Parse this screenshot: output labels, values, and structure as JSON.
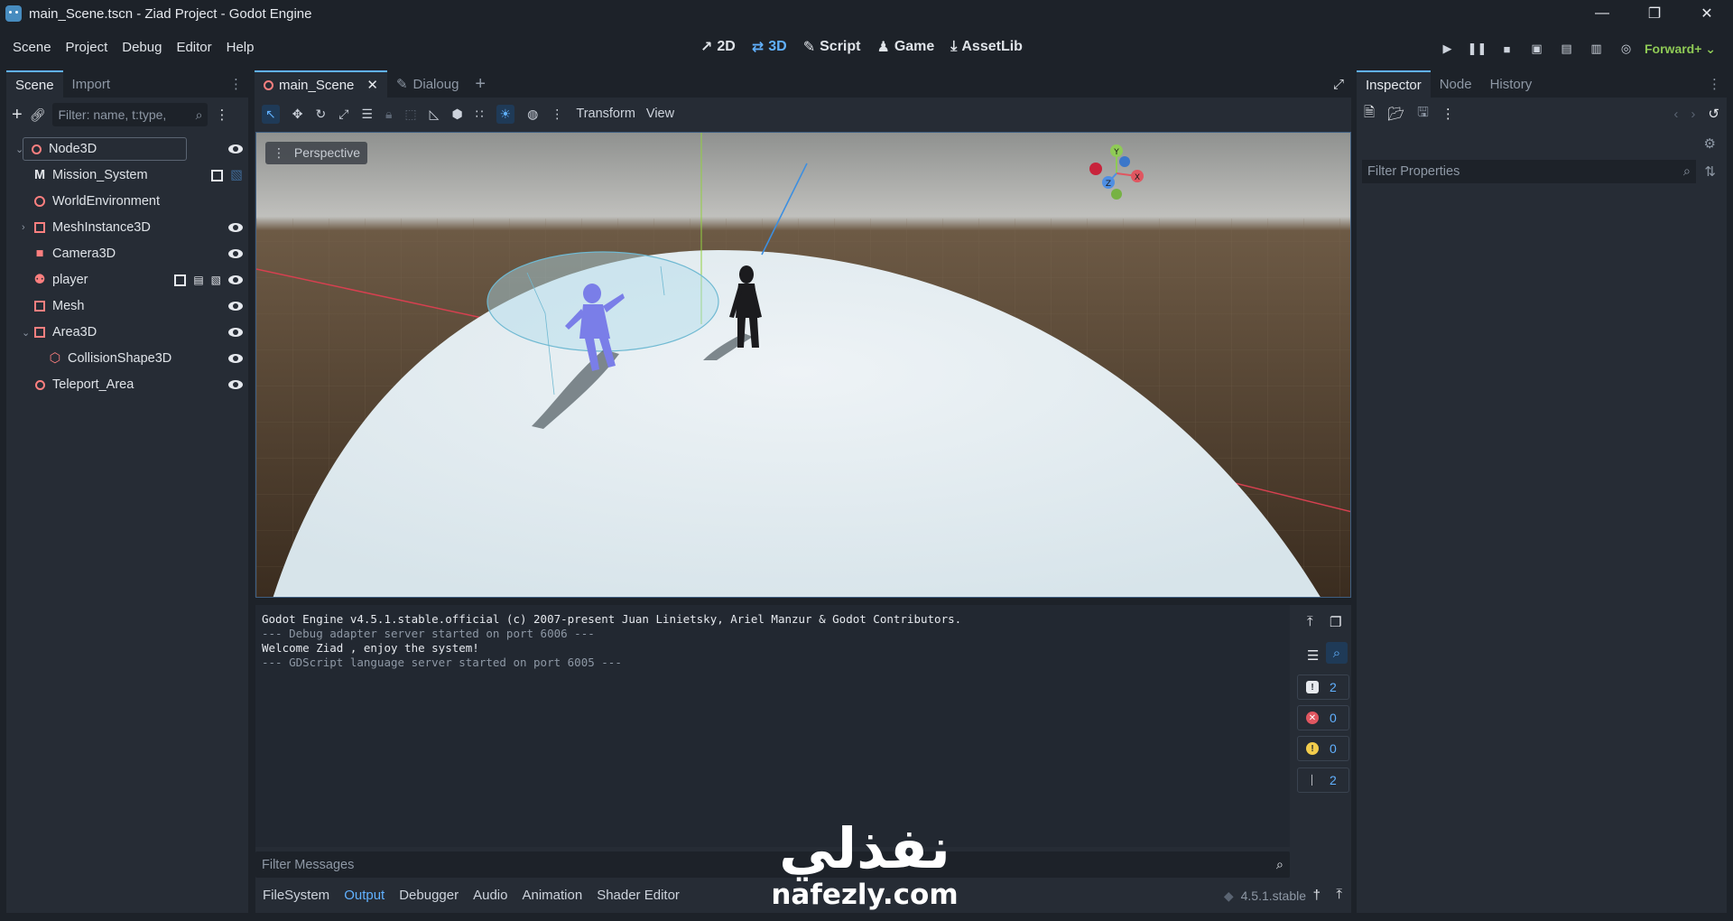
{
  "window": {
    "title": "main_Scene.tscn - Ziad Project - Godot Engine",
    "buttons": [
      "minimize",
      "restore",
      "close"
    ]
  },
  "menu": [
    "Scene",
    "Project",
    "Debug",
    "Editor",
    "Help"
  ],
  "modes": [
    {
      "label": "2D",
      "icon": "2d-icon"
    },
    {
      "label": "3D",
      "icon": "3d-icon",
      "active": true
    },
    {
      "label": "Script",
      "icon": "script-icon"
    },
    {
      "label": "Game",
      "icon": "game-icon"
    },
    {
      "label": "AssetLib",
      "icon": "assetlib-icon"
    }
  ],
  "renderer": "Forward+",
  "scene_dock": {
    "tabs": [
      "Scene",
      "Import"
    ],
    "filter_placeholder": "Filter: name, t:type,",
    "nodes": [
      {
        "label": "Node3D",
        "icon": "node3d-icon",
        "color": "#fc7f7f"
      },
      {
        "label": "Mission_System",
        "icon": "node-icon",
        "color": "#e6e9ee"
      },
      {
        "label": "WorldEnvironment",
        "icon": "world-icon",
        "color": "#fc7f7f"
      },
      {
        "label": "MeshInstance3D",
        "icon": "mesh-icon",
        "color": "#fc7f7f"
      },
      {
        "label": "Camera3D",
        "icon": "camera-icon",
        "color": "#fc7f7f"
      },
      {
        "label": "player",
        "icon": "character-icon",
        "color": "#fc7f7f"
      },
      {
        "label": "Mesh",
        "icon": "mesh-icon",
        "color": "#fc7f7f"
      },
      {
        "label": "Area3D",
        "icon": "area-icon",
        "color": "#fc7f7f"
      },
      {
        "label": "CollisionShape3D",
        "icon": "collision-icon",
        "color": "#fc7f7f"
      },
      {
        "label": "Teleport_Area",
        "icon": "node3d-icon",
        "color": "#fc7f7f"
      }
    ]
  },
  "editor_tabs": [
    {
      "label": "main_Scene",
      "active": true
    },
    {
      "label": "Dialoug",
      "active": false
    }
  ],
  "viewport_toolbar": {
    "transform_label": "Transform",
    "view_label": "View",
    "perspective_label": "Perspective"
  },
  "gizmo": {
    "x": "X",
    "y": "Y",
    "z": "Z"
  },
  "output": {
    "lines": [
      {
        "text": "Godot Engine v4.5.1.stable.official (c) 2007-present Juan Linietsky, Ariel Manzur & Godot Contributors.",
        "style": "white"
      },
      {
        "text": "--- Debug adapter server started on port 6006 ---",
        "style": "dim"
      },
      {
        "text": "Welcome Ziad , enjoy the system!",
        "style": "white"
      },
      {
        "text": "--- GDScript language server started on port 6005 ---",
        "style": "dim"
      }
    ],
    "counts": {
      "messages": "2",
      "errors": "0",
      "warnings": "0",
      "editor": "2"
    },
    "filter_placeholder": "Filter Messages"
  },
  "bottom_tabs": [
    "FileSystem",
    "Output",
    "Debugger",
    "Audio",
    "Animation",
    "Shader Editor"
  ],
  "version": "4.5.1.stable",
  "inspector": {
    "tabs": [
      "Inspector",
      "Node",
      "History"
    ],
    "filter_placeholder": "Filter Properties"
  },
  "watermark": {
    "arabic": "نفذلي",
    "latin": "nafezly.com"
  },
  "colors": {
    "accent": "#61b1ff",
    "node_red": "#fc7f7f",
    "renderer": "#8fca56",
    "panel": "#262c35",
    "background": "#1d2229"
  }
}
